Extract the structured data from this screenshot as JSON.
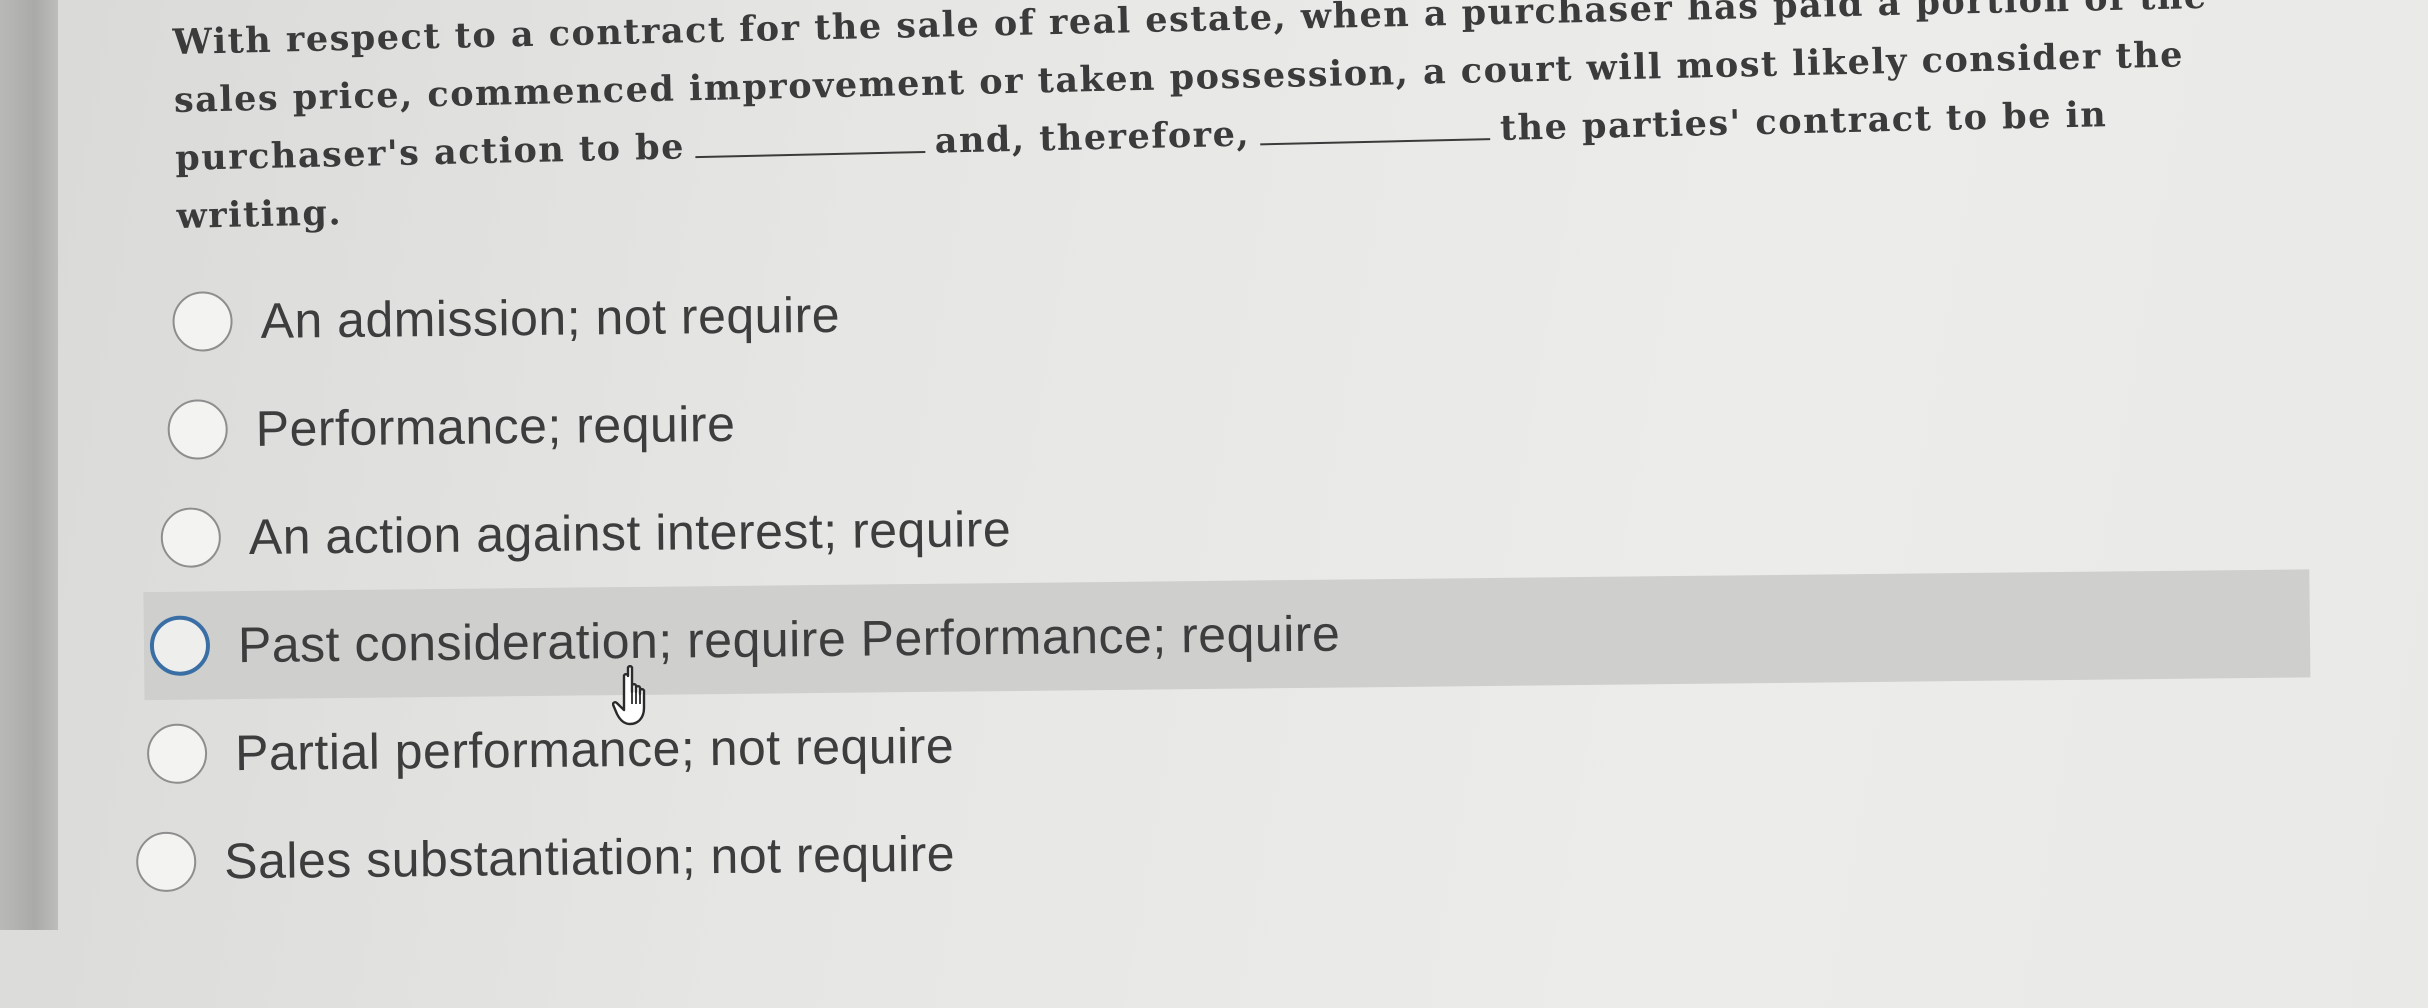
{
  "question": {
    "part1": "With respect to a contract for the sale of real estate, when a purchaser has paid a portion of the sales price, commenced improvement or taken possession, a court will most likely consider the purchaser's action to be",
    "part2": "and, therefore,",
    "part3": "the parties' contract to be in writing."
  },
  "options": [
    {
      "label": "An admission; not require",
      "highlighted": false
    },
    {
      "label": "Performance; require",
      "highlighted": false
    },
    {
      "label": "An action against interest; require",
      "highlighted": false
    },
    {
      "label": "Past consideration; require Performance; require",
      "highlighted": true
    },
    {
      "label": "Partial performance; not require",
      "highlighted": false
    },
    {
      "label": "Sales substantiation; not require",
      "highlighted": false
    }
  ],
  "cursor_icon": "hand-pointer-icon"
}
